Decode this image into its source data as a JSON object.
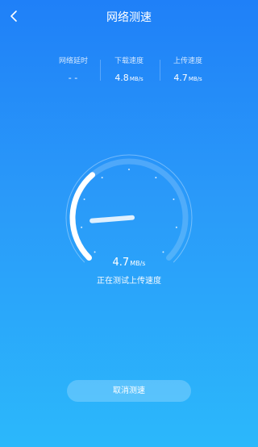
{
  "header": {
    "title": "网络测速",
    "back_icon": "chevron-left-icon"
  },
  "stats": [
    {
      "label": "网络延时",
      "value": "- -",
      "unit": ""
    },
    {
      "label": "下载速度",
      "value": "4.8",
      "unit": "MB/s"
    },
    {
      "label": "上传速度",
      "value": "4.7",
      "unit": "MB/s"
    }
  ],
  "gauge": {
    "value": "4.7",
    "unit": "MB/s",
    "status": "正在测试上传速度",
    "progress_fraction": 0.35,
    "needle_fraction": 0.15
  },
  "cancel_button": {
    "label": "取消测速"
  }
}
